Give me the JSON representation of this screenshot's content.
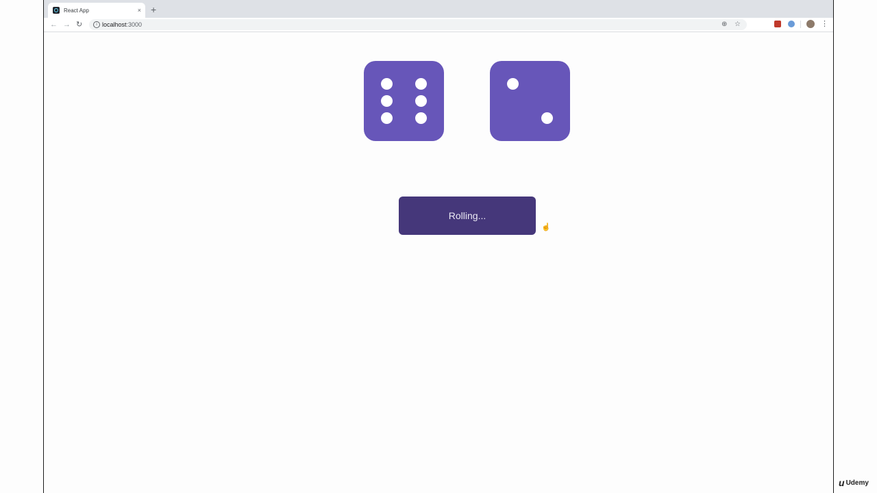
{
  "browser": {
    "tab_title": "React App",
    "tab_close": "×",
    "new_tab": "+",
    "url_host": "localhost",
    "url_port": ":3000",
    "info": "i",
    "back": "←",
    "forward": "→",
    "reload": "↻",
    "zoom": "⊕",
    "star": "☆",
    "menu": "⋮"
  },
  "app": {
    "die1_value": 6,
    "die2_value": 2,
    "die_color": "#6756b9",
    "button_label": "Rolling...",
    "button_color": "#45377a"
  },
  "watermark": {
    "logo": "u",
    "text": "Udemy"
  }
}
